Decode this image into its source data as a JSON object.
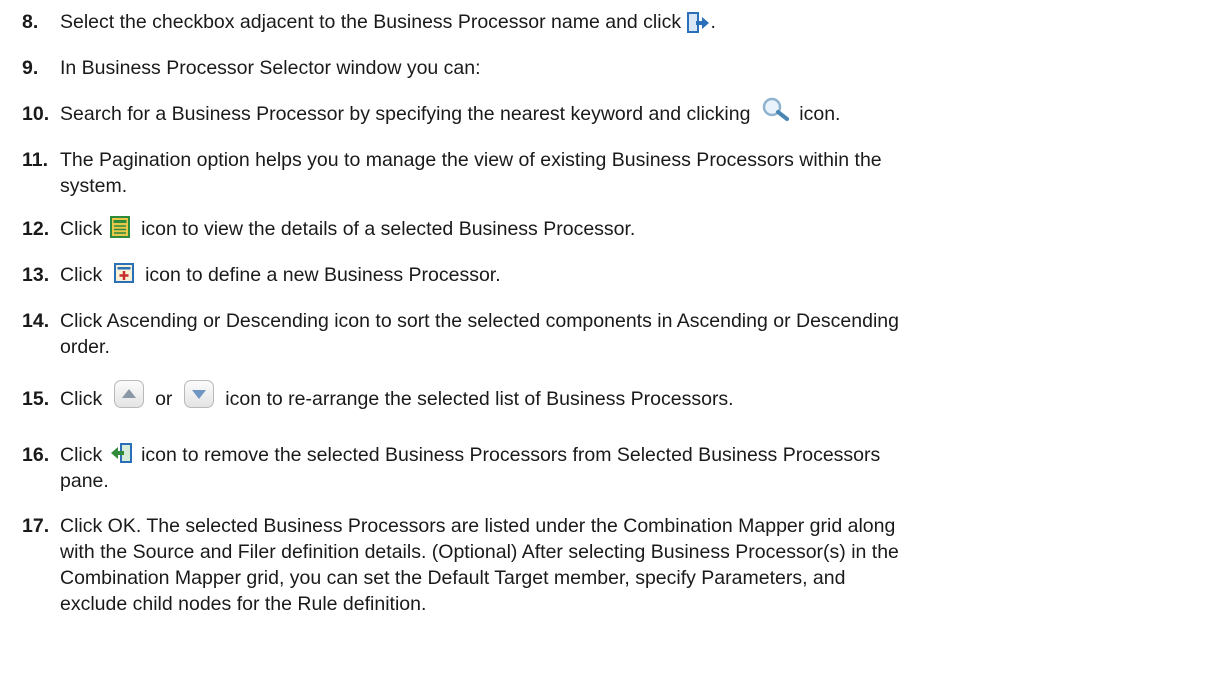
{
  "steps": [
    {
      "number": "8.",
      "parts": [
        "Select the checkbox adjacent to the Business Processor name and click ",
        "."
      ],
      "icon": "move-selected-right-icon"
    },
    {
      "number": "9.",
      "text": "In Business Processor Selector window you can:"
    },
    {
      "number": "10.",
      "parts": [
        "Search for a Business Processor by specifying the nearest keyword and clicking ",
        " icon."
      ],
      "icon": "search-magnifier-icon"
    },
    {
      "number": "11.",
      "lines": [
        "The Pagination option helps you to manage the view of existing Business Processors within the",
        "system."
      ]
    },
    {
      "number": "12.",
      "parts": [
        "Click ",
        " icon to view the details of a selected Business Processor."
      ],
      "icon": "view-details-icon"
    },
    {
      "number": "13.",
      "parts": [
        "Click ",
        " icon to define a new Business Processor."
      ],
      "icon": "add-new-icon"
    },
    {
      "number": "14.",
      "lines": [
        "Click Ascending or Descending icon to sort the selected components in Ascending or Descending",
        "order."
      ]
    },
    {
      "number": "15.",
      "parts": [
        "Click ",
        " or ",
        " icon to re-arrange the selected list of Business Processors."
      ],
      "icons": [
        "move-up-icon",
        "move-down-icon"
      ]
    },
    {
      "number": "16.",
      "lines": [
        "Click ",
        " icon to remove the selected Business Processors from Selected Business Processors",
        "pane."
      ],
      "icon": "remove-selected-icon"
    },
    {
      "number": "17.",
      "lines": [
        "Click OK. The selected Business Processors are listed under the Combination Mapper grid along",
        "with the Source and Filer definition details. (Optional) After selecting Business Processor(s) in the",
        "Combination Mapper grid, you can set the Default Target member, specify Parameters, and",
        "exclude child nodes for the Rule definition."
      ]
    }
  ],
  "colors": {
    "text": "#1a1a1a",
    "icon_blue": "#2a6fb8",
    "icon_green": "#2f8a3a",
    "icon_yellow": "#e8c84a"
  }
}
